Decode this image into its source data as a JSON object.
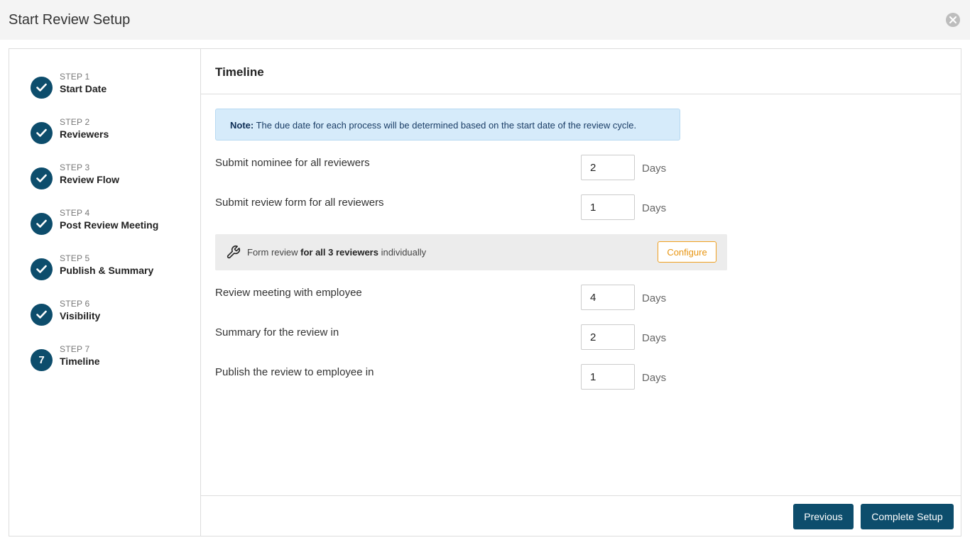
{
  "window": {
    "title": "Start Review Setup"
  },
  "steps": [
    {
      "label": "STEP 1",
      "name": "Start Date",
      "status": "done"
    },
    {
      "label": "STEP 2",
      "name": "Reviewers",
      "status": "done"
    },
    {
      "label": "STEP 3",
      "name": "Review Flow",
      "status": "done"
    },
    {
      "label": "STEP 4",
      "name": "Post Review Meeting",
      "status": "done"
    },
    {
      "label": "STEP 5",
      "name": "Publish & Summary",
      "status": "done"
    },
    {
      "label": "STEP 6",
      "name": "Visibility",
      "status": "done"
    },
    {
      "label": "STEP 7",
      "name": "Timeline",
      "status": "current",
      "number": "7"
    }
  ],
  "main": {
    "title": "Timeline",
    "note": {
      "prefix": "Note:",
      "text": " The due date for each process will be determined based on the start date of the review cycle."
    },
    "rows": [
      {
        "label": "Submit nominee for all reviewers",
        "value": "2",
        "unit": "Days"
      },
      {
        "label": "Submit review form for all reviewers",
        "value": "1",
        "unit": "Days"
      },
      {
        "label": "Review meeting with employee",
        "value": "4",
        "unit": "Days"
      },
      {
        "label": "Summary for the review in",
        "value": "2",
        "unit": "Days"
      },
      {
        "label": "Publish the review to employee in",
        "value": "1",
        "unit": "Days"
      }
    ],
    "form_review": {
      "prefix": "Form review ",
      "bold": "for all 3 reviewers",
      "suffix": " individually",
      "configure_label": "Configure"
    }
  },
  "footer": {
    "previous_label": "Previous",
    "complete_label": "Complete Setup"
  },
  "colors": {
    "primary": "#0d4d6c",
    "accent": "#e89511",
    "note_bg": "#d6ebfa"
  }
}
